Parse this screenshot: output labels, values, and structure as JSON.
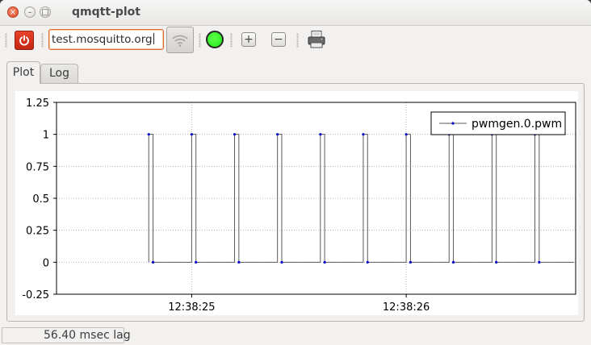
{
  "window": {
    "title": "qmqtt-plot"
  },
  "toolbar": {
    "host_value": "test.mosquitto.org",
    "zoom_in_label": "+",
    "zoom_out_label": "−",
    "status_led_color": "#1ee815"
  },
  "tabs": [
    {
      "label": "Plot",
      "active": true
    },
    {
      "label": "Log",
      "active": false
    }
  ],
  "status": {
    "lag_text": "56.40 msec lag"
  },
  "chart_data": {
    "type": "line",
    "title": "",
    "xlabel": "",
    "ylabel": "",
    "ylim": [
      -0.25,
      1.25
    ],
    "yticks": [
      "1.25",
      "1",
      "0.75",
      "0.5",
      "0.25",
      "0",
      "-0.25"
    ],
    "xticks": [
      "12:38:25",
      "12:38:26"
    ],
    "grid": true,
    "legend_position": "top-right",
    "series": [
      {
        "name": "pwmgen.0.pwm",
        "color": "#5a5a5a",
        "marker_color": "#0000cc",
        "step": true,
        "points": [
          {
            "x": 0.8,
            "y": 1
          },
          {
            "x": 0.82,
            "y": 0
          },
          {
            "x": 1.0,
            "y": 1
          },
          {
            "x": 1.02,
            "y": 0
          },
          {
            "x": 1.2,
            "y": 1
          },
          {
            "x": 1.22,
            "y": 0
          },
          {
            "x": 1.4,
            "y": 1
          },
          {
            "x": 1.42,
            "y": 0
          },
          {
            "x": 1.6,
            "y": 1
          },
          {
            "x": 1.62,
            "y": 0
          },
          {
            "x": 1.8,
            "y": 1
          },
          {
            "x": 1.82,
            "y": 0
          },
          {
            "x": 2.0,
            "y": 1
          },
          {
            "x": 2.02,
            "y": 0
          },
          {
            "x": 2.2,
            "y": 1
          },
          {
            "x": 2.22,
            "y": 0
          },
          {
            "x": 2.4,
            "y": 1
          },
          {
            "x": 2.42,
            "y": 0
          },
          {
            "x": 2.6,
            "y": 1
          },
          {
            "x": 2.62,
            "y": 0
          }
        ]
      }
    ]
  }
}
